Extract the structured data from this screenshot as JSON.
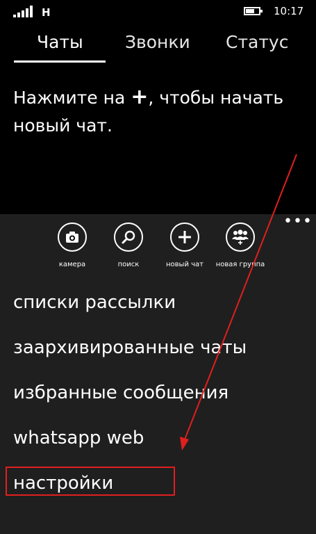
{
  "status_bar": {
    "network": "H",
    "time": "10:17"
  },
  "tabs": [
    {
      "label": "Чаты",
      "selected": true
    },
    {
      "label": "Звонки",
      "selected": false
    },
    {
      "label": "Статус",
      "selected": false
    }
  ],
  "empty_state": {
    "before": "Нажмите на",
    "plus": "+",
    "after": ", чтобы начать новый чат."
  },
  "app_bar": {
    "more": "•••",
    "actions": [
      {
        "label": "камера",
        "icon": "camera-icon"
      },
      {
        "label": "поиск",
        "icon": "search-icon"
      },
      {
        "label": "новый чат",
        "icon": "plus-icon"
      },
      {
        "label": "новая группа",
        "icon": "group-icon"
      }
    ],
    "menu": [
      "списки рассылки",
      "заархивированные чаты",
      "избранные сообщения",
      "whatsapp web",
      "настройки"
    ]
  },
  "colors": {
    "annotation": "#e01f1f",
    "app_bar_bg": "#1f1f1f",
    "background": "#000000"
  }
}
